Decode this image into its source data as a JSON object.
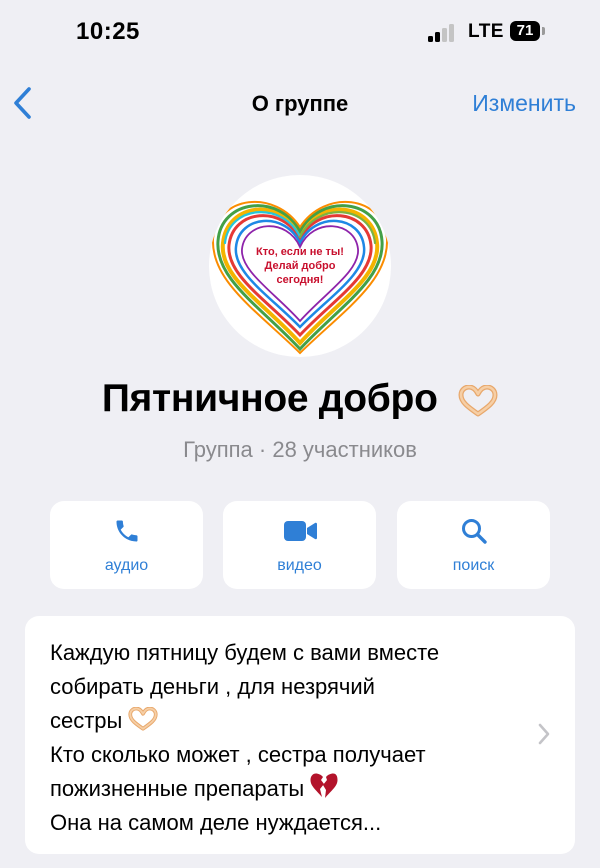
{
  "status_bar": {
    "time": "10:25",
    "network": "LTE",
    "battery": "71"
  },
  "nav": {
    "title": "О группе",
    "edit_label": "Изменить"
  },
  "avatar": {
    "text_lines": [
      "Кто, если не ты!",
      "Делай добро",
      "сегодня!"
    ]
  },
  "group": {
    "name": "Пятничное добро",
    "subtitle": "Группа · 28 участников"
  },
  "actions": [
    {
      "label": "аудио",
      "icon": "phone-icon"
    },
    {
      "label": "видео",
      "icon": "video-camera-icon"
    },
    {
      "label": "поиск",
      "icon": "search-icon"
    }
  ],
  "description": {
    "lines": [
      "Каждую пятницу будем с вами вместе",
      "собирать деньги , для незрячий",
      "сестры",
      "Кто сколько может , сестра получает",
      "пожизненные препараты",
      "Она на самом деле нуждается..."
    ]
  },
  "colors": {
    "accent": "#2F7FD6",
    "background": "#EFEFF4",
    "subtitle": "#8A8A8E",
    "avatar_text": "#C8102E"
  }
}
